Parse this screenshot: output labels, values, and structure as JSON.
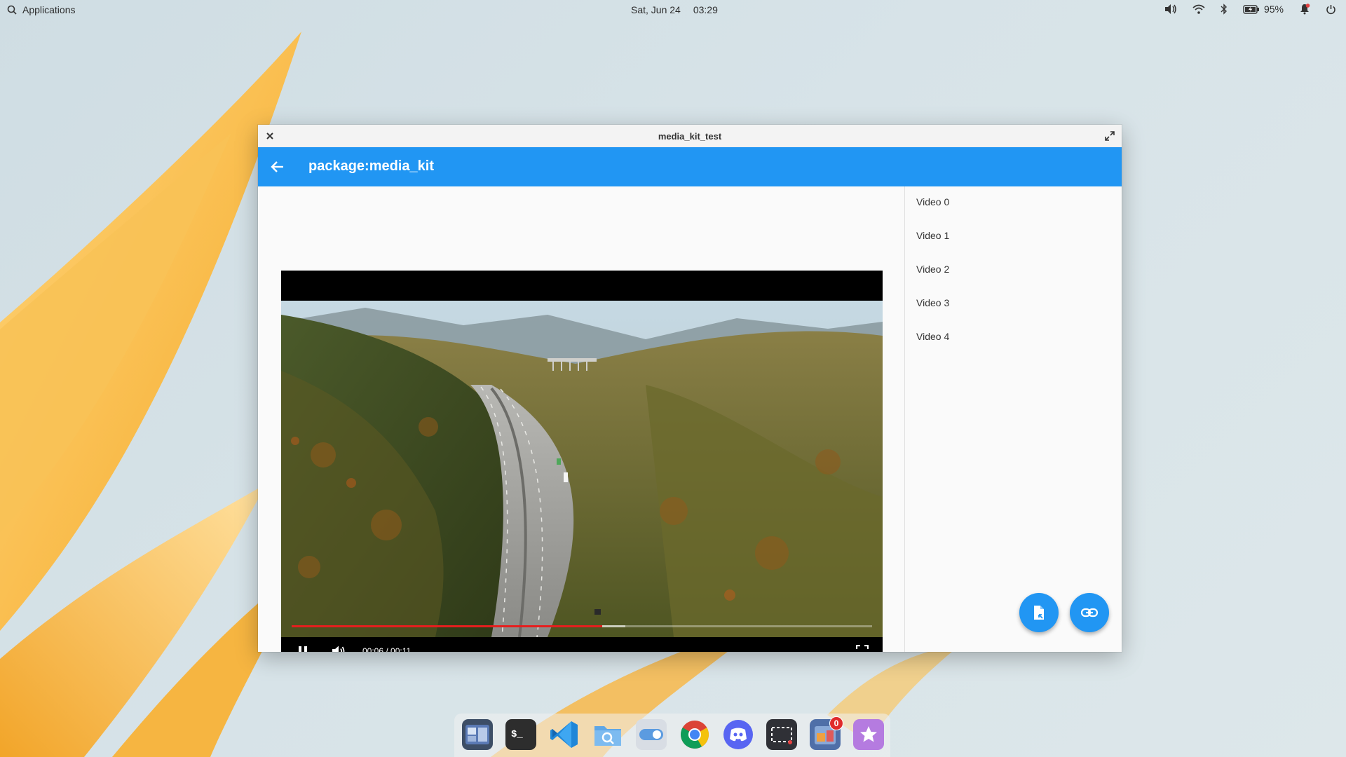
{
  "topbar": {
    "applications_label": "Applications",
    "date": "Sat, Jun 24",
    "time": "03:29",
    "battery": "95%"
  },
  "window": {
    "title": "media_kit_test"
  },
  "appbar": {
    "title": "package:media_kit"
  },
  "player": {
    "timecode": "00:06 / 00:11",
    "progress": 0.535,
    "buffered": 0.575
  },
  "playlist": [
    {
      "label": "Video 0"
    },
    {
      "label": "Video 1"
    },
    {
      "label": "Video 2"
    },
    {
      "label": "Video 3"
    },
    {
      "label": "Video 4"
    }
  ],
  "dock": {
    "items": [
      {
        "icon": "multitasking-view-icon"
      },
      {
        "icon": "terminal-icon"
      },
      {
        "icon": "vscode-icon"
      },
      {
        "icon": "files-search-icon"
      },
      {
        "icon": "system-settings-icon"
      },
      {
        "icon": "chrome-icon"
      },
      {
        "icon": "discord-icon"
      },
      {
        "icon": "screenshot-icon"
      },
      {
        "icon": "appcenter-icon",
        "badge": "0"
      },
      {
        "icon": "favorites-star-icon"
      }
    ]
  },
  "colors": {
    "accent": "#2196f3",
    "progress": "#e61e1e"
  }
}
